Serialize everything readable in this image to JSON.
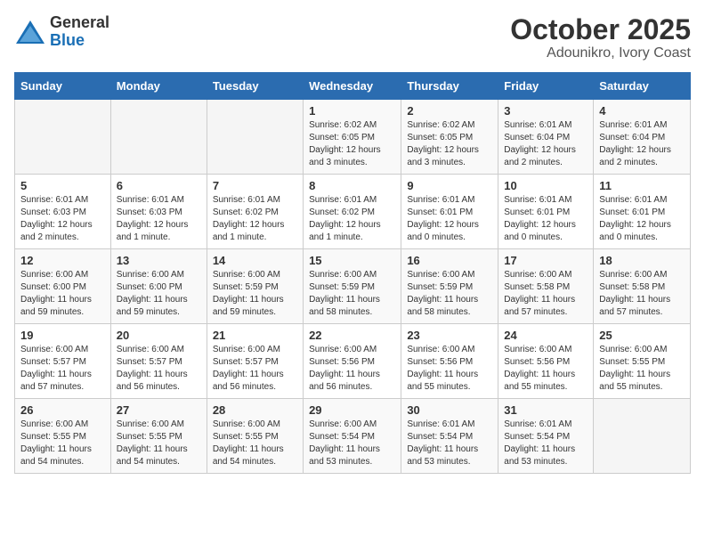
{
  "header": {
    "logo_general": "General",
    "logo_blue": "Blue",
    "title": "October 2025",
    "subtitle": "Adounikro, Ivory Coast"
  },
  "calendar": {
    "days_of_week": [
      "Sunday",
      "Monday",
      "Tuesday",
      "Wednesday",
      "Thursday",
      "Friday",
      "Saturday"
    ],
    "weeks": [
      [
        {
          "day": "",
          "info": ""
        },
        {
          "day": "",
          "info": ""
        },
        {
          "day": "",
          "info": ""
        },
        {
          "day": "1",
          "info": "Sunrise: 6:02 AM\nSunset: 6:05 PM\nDaylight: 12 hours and 3 minutes."
        },
        {
          "day": "2",
          "info": "Sunrise: 6:02 AM\nSunset: 6:05 PM\nDaylight: 12 hours and 3 minutes."
        },
        {
          "day": "3",
          "info": "Sunrise: 6:01 AM\nSunset: 6:04 PM\nDaylight: 12 hours and 2 minutes."
        },
        {
          "day": "4",
          "info": "Sunrise: 6:01 AM\nSunset: 6:04 PM\nDaylight: 12 hours and 2 minutes."
        }
      ],
      [
        {
          "day": "5",
          "info": "Sunrise: 6:01 AM\nSunset: 6:03 PM\nDaylight: 12 hours and 2 minutes."
        },
        {
          "day": "6",
          "info": "Sunrise: 6:01 AM\nSunset: 6:03 PM\nDaylight: 12 hours and 1 minute."
        },
        {
          "day": "7",
          "info": "Sunrise: 6:01 AM\nSunset: 6:02 PM\nDaylight: 12 hours and 1 minute."
        },
        {
          "day": "8",
          "info": "Sunrise: 6:01 AM\nSunset: 6:02 PM\nDaylight: 12 hours and 1 minute."
        },
        {
          "day": "9",
          "info": "Sunrise: 6:01 AM\nSunset: 6:01 PM\nDaylight: 12 hours and 0 minutes."
        },
        {
          "day": "10",
          "info": "Sunrise: 6:01 AM\nSunset: 6:01 PM\nDaylight: 12 hours and 0 minutes."
        },
        {
          "day": "11",
          "info": "Sunrise: 6:01 AM\nSunset: 6:01 PM\nDaylight: 12 hours and 0 minutes."
        }
      ],
      [
        {
          "day": "12",
          "info": "Sunrise: 6:00 AM\nSunset: 6:00 PM\nDaylight: 11 hours and 59 minutes."
        },
        {
          "day": "13",
          "info": "Sunrise: 6:00 AM\nSunset: 6:00 PM\nDaylight: 11 hours and 59 minutes."
        },
        {
          "day": "14",
          "info": "Sunrise: 6:00 AM\nSunset: 5:59 PM\nDaylight: 11 hours and 59 minutes."
        },
        {
          "day": "15",
          "info": "Sunrise: 6:00 AM\nSunset: 5:59 PM\nDaylight: 11 hours and 58 minutes."
        },
        {
          "day": "16",
          "info": "Sunrise: 6:00 AM\nSunset: 5:59 PM\nDaylight: 11 hours and 58 minutes."
        },
        {
          "day": "17",
          "info": "Sunrise: 6:00 AM\nSunset: 5:58 PM\nDaylight: 11 hours and 57 minutes."
        },
        {
          "day": "18",
          "info": "Sunrise: 6:00 AM\nSunset: 5:58 PM\nDaylight: 11 hours and 57 minutes."
        }
      ],
      [
        {
          "day": "19",
          "info": "Sunrise: 6:00 AM\nSunset: 5:57 PM\nDaylight: 11 hours and 57 minutes."
        },
        {
          "day": "20",
          "info": "Sunrise: 6:00 AM\nSunset: 5:57 PM\nDaylight: 11 hours and 56 minutes."
        },
        {
          "day": "21",
          "info": "Sunrise: 6:00 AM\nSunset: 5:57 PM\nDaylight: 11 hours and 56 minutes."
        },
        {
          "day": "22",
          "info": "Sunrise: 6:00 AM\nSunset: 5:56 PM\nDaylight: 11 hours and 56 minutes."
        },
        {
          "day": "23",
          "info": "Sunrise: 6:00 AM\nSunset: 5:56 PM\nDaylight: 11 hours and 55 minutes."
        },
        {
          "day": "24",
          "info": "Sunrise: 6:00 AM\nSunset: 5:56 PM\nDaylight: 11 hours and 55 minutes."
        },
        {
          "day": "25",
          "info": "Sunrise: 6:00 AM\nSunset: 5:55 PM\nDaylight: 11 hours and 55 minutes."
        }
      ],
      [
        {
          "day": "26",
          "info": "Sunrise: 6:00 AM\nSunset: 5:55 PM\nDaylight: 11 hours and 54 minutes."
        },
        {
          "day": "27",
          "info": "Sunrise: 6:00 AM\nSunset: 5:55 PM\nDaylight: 11 hours and 54 minutes."
        },
        {
          "day": "28",
          "info": "Sunrise: 6:00 AM\nSunset: 5:55 PM\nDaylight: 11 hours and 54 minutes."
        },
        {
          "day": "29",
          "info": "Sunrise: 6:00 AM\nSunset: 5:54 PM\nDaylight: 11 hours and 53 minutes."
        },
        {
          "day": "30",
          "info": "Sunrise: 6:01 AM\nSunset: 5:54 PM\nDaylight: 11 hours and 53 minutes."
        },
        {
          "day": "31",
          "info": "Sunrise: 6:01 AM\nSunset: 5:54 PM\nDaylight: 11 hours and 53 minutes."
        },
        {
          "day": "",
          "info": ""
        }
      ]
    ]
  }
}
